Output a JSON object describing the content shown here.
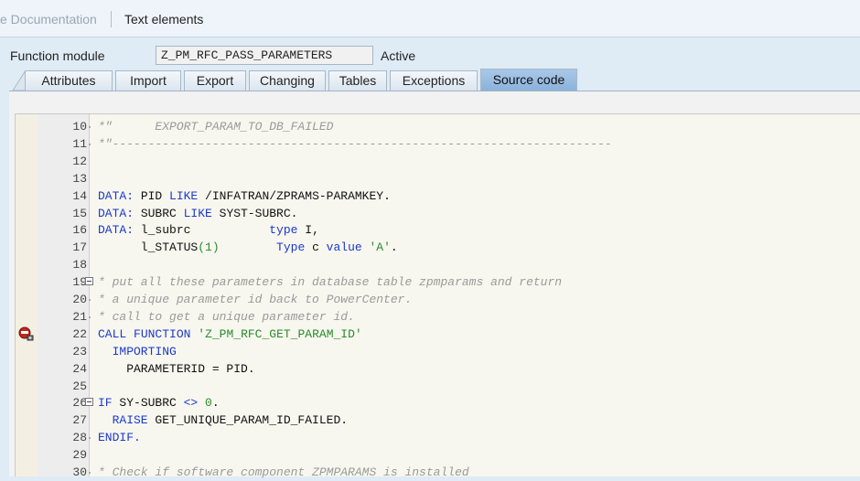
{
  "toolbar": {
    "documentation": "e Documentation",
    "text_elements": "Text elements"
  },
  "header": {
    "fm_label": "Function module",
    "fm_name": "Z_PM_RFC_PASS_PARAMETERS",
    "status": "Active"
  },
  "tabs": [
    "Attributes",
    "Import",
    "Export",
    "Changing",
    "Tables",
    "Exceptions",
    "Source code"
  ],
  "active_tab": "Source code",
  "colors": {
    "keyword": "#1d39c9",
    "comment": "#9a9a9a",
    "string": "#2b8a2b",
    "active_tab": "#8bb2db"
  },
  "lines": [
    {
      "n": "10",
      "fold": "dot",
      "parts": [
        [
          "*\"      EXPORT_PARAM_TO_DB_FAILED",
          "cm"
        ]
      ]
    },
    {
      "n": "11",
      "fold": "dot",
      "parts": [
        [
          "*\"----------------------------------------------------------------------",
          "cm"
        ]
      ]
    },
    {
      "n": "12",
      "parts": []
    },
    {
      "n": "13",
      "parts": []
    },
    {
      "n": "14",
      "parts": [
        [
          "DATA:",
          "kw"
        ],
        [
          " PID ",
          ""
        ],
        [
          "LIKE",
          "kw"
        ],
        [
          " /INFATRAN/ZPRAMS-PARAMKEY.",
          ""
        ]
      ]
    },
    {
      "n": "15",
      "parts": [
        [
          "DATA:",
          "kw"
        ],
        [
          " SUBRC ",
          ""
        ],
        [
          "LIKE",
          "kw"
        ],
        [
          " SYST-SUBRC.",
          ""
        ]
      ]
    },
    {
      "n": "16",
      "parts": [
        [
          "DATA:",
          "kw"
        ],
        [
          " l_subrc           ",
          ""
        ],
        [
          "type",
          "kw"
        ],
        [
          " I,",
          ""
        ]
      ]
    },
    {
      "n": "17",
      "parts": [
        [
          "      l_STATUS",
          ""
        ],
        [
          "(1)",
          "num"
        ],
        [
          "        ",
          ""
        ],
        [
          "Type",
          "kw"
        ],
        [
          " c ",
          ""
        ],
        [
          "value",
          "kw"
        ],
        [
          " ",
          ""
        ],
        [
          "'A'",
          "str"
        ],
        [
          ".",
          ""
        ]
      ]
    },
    {
      "n": "18",
      "parts": []
    },
    {
      "n": "19",
      "fold": "box",
      "parts": [
        [
          "* put all these parameters in database table zpmparams and return",
          "cm"
        ]
      ]
    },
    {
      "n": "20",
      "fold": "dot",
      "parts": [
        [
          "* a unique parameter id back to PowerCenter.",
          "cm"
        ]
      ]
    },
    {
      "n": "21",
      "fold": "dot",
      "parts": [
        [
          "* call to get a unique parameter id.",
          "cm"
        ]
      ]
    },
    {
      "n": "22",
      "bp": true,
      "parts": [
        [
          "CALL",
          "kw"
        ],
        [
          " ",
          ""
        ],
        [
          "FUNCTION",
          "kw"
        ],
        [
          " ",
          ""
        ],
        [
          "'Z_PM_RFC_GET_PARAM_ID'",
          "str"
        ]
      ]
    },
    {
      "n": "23",
      "parts": [
        [
          "  IMPORTING",
          "kw"
        ]
      ]
    },
    {
      "n": "24",
      "parts": [
        [
          "    PARAMETERID = PID.",
          ""
        ]
      ]
    },
    {
      "n": "25",
      "parts": []
    },
    {
      "n": "26",
      "fold": "box",
      "parts": [
        [
          "IF",
          "kw"
        ],
        [
          " SY-SUBRC ",
          ""
        ],
        [
          "<>",
          "kw"
        ],
        [
          " ",
          ""
        ],
        [
          "0",
          "num"
        ],
        [
          ".",
          ""
        ]
      ]
    },
    {
      "n": "27",
      "parts": [
        [
          "  RAISE",
          "kw"
        ],
        [
          " GET_UNIQUE_PARAM_ID_FAILED.",
          ""
        ]
      ]
    },
    {
      "n": "28",
      "fold": "dot",
      "parts": [
        [
          "ENDIF.",
          "kw"
        ]
      ]
    },
    {
      "n": "29",
      "parts": []
    },
    {
      "n": "30",
      "fold": "dot",
      "parts": [
        [
          "* Check if software component ZPMPARAMS is installed",
          "cm"
        ]
      ]
    }
  ]
}
